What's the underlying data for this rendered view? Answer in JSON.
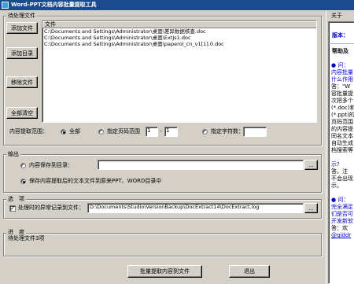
{
  "window": {
    "title": "Word-PPT文档内容批量提取工具"
  },
  "pending": {
    "legend": "待处理文件",
    "buttons": {
      "add_file": "添加文件",
      "add_dir": "添加目录",
      "remove_file": "移除文件",
      "clear_all": "全部清空"
    },
    "file_list": {
      "column_header": "文件",
      "rows": [
        "C:\\Documents and Settings\\Administrator\\桌面\\差异数据核查.doc",
        "C:\\Documents and Settings\\Administrator\\桌面\\ExtJs1.doc",
        "C:\\Documents and Settings\\Administrator\\桌面\\paperol_cn_v1[1].0.doc"
      ]
    },
    "range": {
      "label": "内容提取范围：",
      "all": "全部",
      "page_range": "指定页码范围",
      "from": "1",
      "sep": "-",
      "to": "1",
      "char_count": "指定字符数：",
      "char_value": "",
      "selected": "all"
    }
  },
  "output": {
    "legend": "输出",
    "save_to_dir": "内容保存到目录：",
    "save_to_dir_value": "",
    "browse": "...",
    "save_same_dir": "保存内容提取后的文本文件到原来PPT、WORD目录中",
    "selected": "same_dir"
  },
  "options": {
    "legend": "选　项",
    "log_label": "处理时的异常记录到文件：",
    "log_checked": true,
    "log_path": "D:\\Documents\\Studio\\VersionBackup\\DocExtract14\\DocExtract.log",
    "browse": "..."
  },
  "progress": {
    "legend": "进　度",
    "status": "待处理文件3项"
  },
  "footer": {
    "extract_button": "批量提取内容到文件",
    "exit_button": "退出"
  },
  "right_panel": {
    "tab_label": "关于",
    "version_label": "版本：",
    "help_heading": "帮助及",
    "lines": [
      "● 问：",
      "内容批量",
      "什么作用",
      "答：\"W",
      "容批量提",
      "次把多个",
      "(*.doc)和",
      "(*.ppt)的",
      "页码范围",
      "的内容提",
      "同名文本",
      "自动生成",
      "档搜索等",
      "示?",
      "答。注",
      "不会出现",
      "示。",
      "● 问：",
      "完全满足",
      "们是否可",
      "开发新软",
      "答：欢",
      "@qiddr"
    ]
  }
}
